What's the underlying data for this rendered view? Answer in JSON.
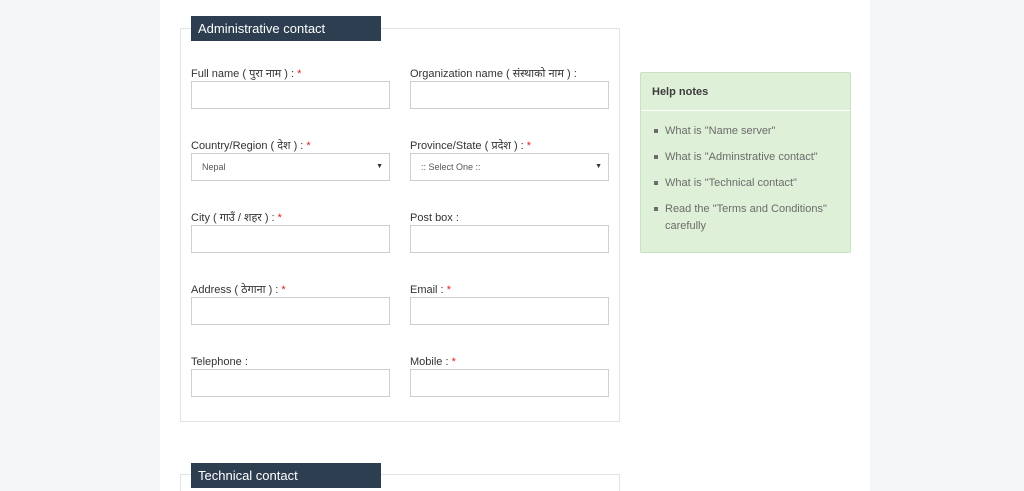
{
  "admin": {
    "legend": "Administrative contact",
    "full_name_label": "Full name ( पुरा नाम ) : ",
    "org_name_label": "Organization name ( संस्थाको नाम ) :",
    "country_label": "Country/Region ( देश ) : ",
    "country_value": "Nepal",
    "province_label": "Province/State ( प्रदेश ) : ",
    "province_value": ":: Select One ::",
    "city_label": "City ( गाउँ / शहर ) : ",
    "postbox_label": "Post box :",
    "address_label": "Address ( ठेगाना ) : ",
    "email_label": "Email : ",
    "telephone_label": "Telephone :",
    "mobile_label": "Mobile : ",
    "required_mark": "*"
  },
  "technical": {
    "legend": "Technical contact"
  },
  "help": {
    "title": "Help notes",
    "items": [
      "What is \"Name server\"",
      "What is \"Adminstrative contact\"",
      "What is \"Technical contact\"",
      "Read the \"Terms and Conditions\" carefully"
    ]
  },
  "icons": {
    "select_caret": "caret-down-icon",
    "list_bullet": "square-bullet-icon"
  },
  "colors": {
    "legend_bg": "#2c3e50",
    "help_bg": "#dff0d8",
    "required": "#e02020"
  }
}
